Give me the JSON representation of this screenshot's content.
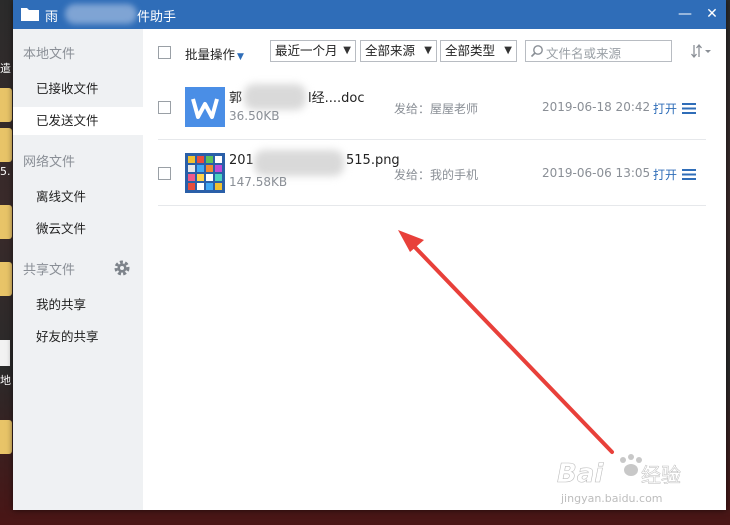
{
  "desktop": {
    "side_texts": [
      "遣",
      "5.",
      "地"
    ]
  },
  "window": {
    "title_start": "雨",
    "title_end": "件助手",
    "minimize_symbol": "—",
    "close_symbol": "✕"
  },
  "sidebar": {
    "sections": [
      {
        "label": "本地文件",
        "items": [
          "已接收文件",
          "已发送文件"
        ]
      },
      {
        "label": "网络文件",
        "items": [
          "离线文件",
          "微云文件"
        ]
      },
      {
        "label": "共享文件",
        "items": [
          "我的共享",
          "好友的共享"
        ]
      }
    ],
    "active_item": "已发送文件"
  },
  "toolbar": {
    "batch_label": "批量操作",
    "filter_time": "最近一个月",
    "filter_source": "全部来源",
    "filter_type": "全部类型",
    "search_placeholder": "文件名或来源"
  },
  "files": [
    {
      "name_start": "郭",
      "name_end": "l经....doc",
      "size": "36.50KB",
      "sent_to": "发给：屋屋老师",
      "date": "2019-06-18 20:42",
      "open_label": "打开",
      "icon": "wps-doc-icon"
    },
    {
      "name_start": "201",
      "name_end": "515.png",
      "size": "147.58KB",
      "sent_to": "发给：我的手机",
      "date": "2019-06-06 13:05",
      "open_label": "打开",
      "icon": "image-thumbnail-icon"
    }
  ],
  "watermark": {
    "brand_left": "Bai",
    "brand_right": "经验",
    "url": "jingyan.baidu.com"
  },
  "colors": {
    "titlebar": "#2f6db8",
    "link": "#2f6db8",
    "annotation_arrow": "#e8403a",
    "sidebar_bg": "#eff1f3"
  }
}
